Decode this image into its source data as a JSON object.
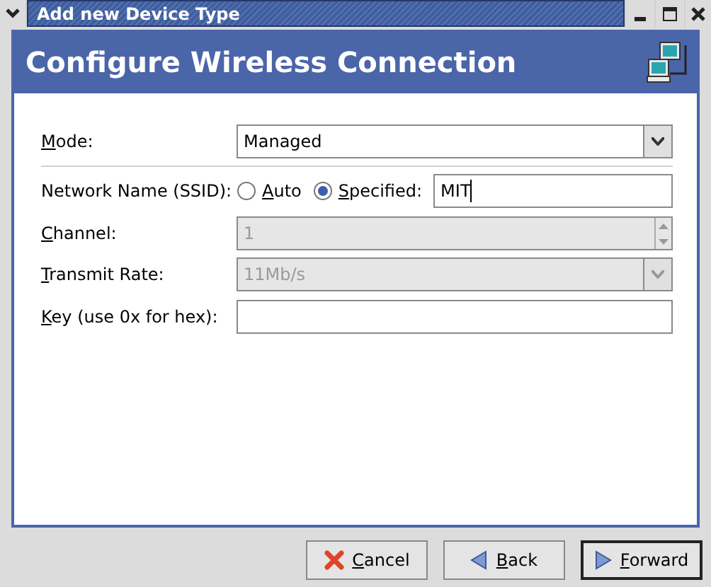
{
  "window": {
    "title": "Add new Device Type"
  },
  "header": {
    "title": "Configure Wireless Connection"
  },
  "mode": {
    "label": "Mode:",
    "mnemonic": true,
    "value": "Managed",
    "disabled": false
  },
  "ssid": {
    "label": "Network Name (SSID):",
    "mnemonic": false,
    "options": [
      {
        "label": "Auto",
        "mnemonic": true,
        "selected": false
      },
      {
        "label": "Specified:",
        "mnemonic": true,
        "selected": true
      }
    ],
    "value": "MIT"
  },
  "channel": {
    "label": "Channel:",
    "mnemonic": true,
    "value": "1",
    "disabled": true
  },
  "transmit_rate": {
    "label": "Transmit Rate:",
    "mnemonic": true,
    "value": "11Mb/s",
    "disabled": true
  },
  "key": {
    "label": "Key (use 0x for hex):",
    "mnemonic": true
  },
  "buttons": [
    {
      "kind": "cancel",
      "label": "Cancel",
      "mnemonic": true,
      "default": false
    },
    {
      "kind": "back",
      "label": "Back",
      "mnemonic": true,
      "default": false
    },
    {
      "kind": "forward",
      "label": "Forward",
      "mnemonic": true,
      "default": true
    }
  ]
}
